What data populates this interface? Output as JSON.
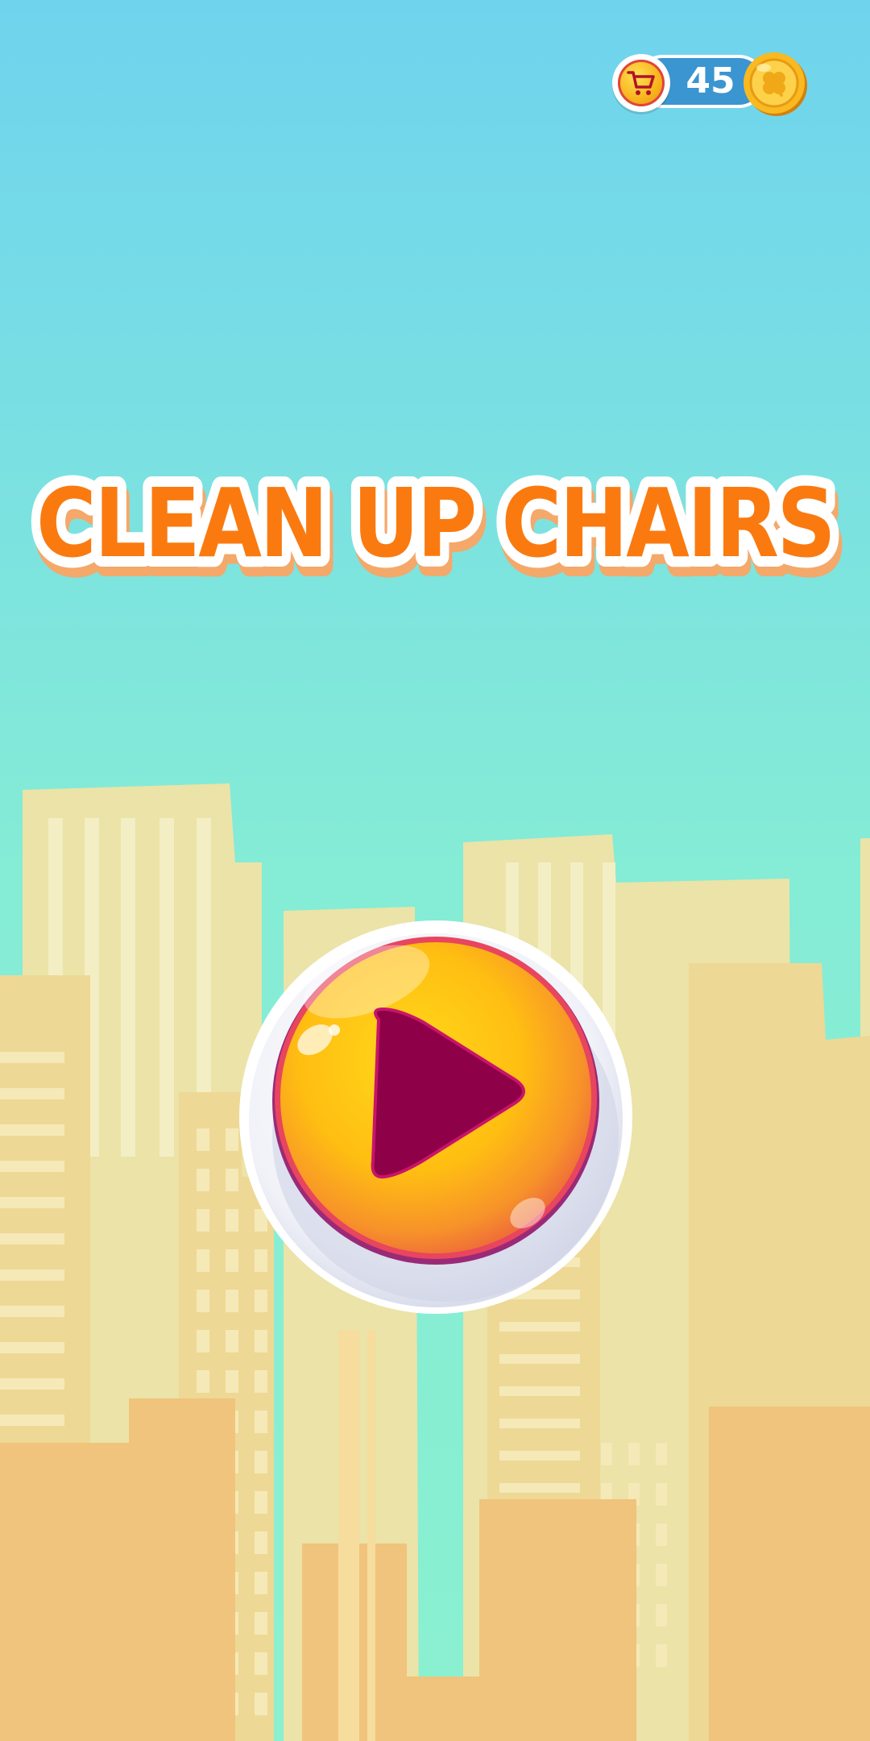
{
  "game": {
    "title": "CLEAN UP CHAIRS"
  },
  "hud": {
    "coins": "45",
    "shop_icon": "cart-icon",
    "coin_icon": "clover-coin-icon"
  },
  "play_button": {
    "icon": "play-icon"
  },
  "colors": {
    "sky_top": "#6fd3ee",
    "sky_bottom": "#8af0d0",
    "title_fill": "#fa7a10",
    "title_outline": "#ffffff",
    "title_shadow": "#f4a86a",
    "play_ring": "#e8455e",
    "play_face": "#ffc70a",
    "play_triangle": "#8e0048",
    "coin_pill": "#3b95d0",
    "coin_gold": "#f8b51c"
  }
}
